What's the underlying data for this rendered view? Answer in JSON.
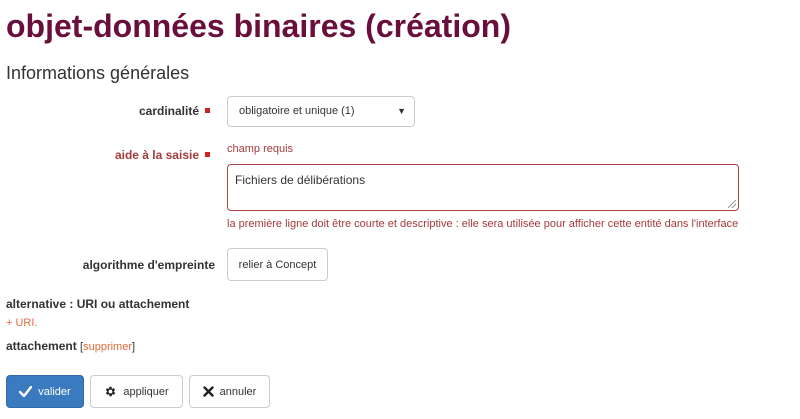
{
  "header": {
    "title": "objet-données binaires (création)",
    "section": "Informations générales"
  },
  "form": {
    "cardinality": {
      "label": "cardinalité",
      "selected": "obligatoire et unique (1)"
    },
    "help": {
      "label": "aide à la saisie",
      "error": "champ requis",
      "value": "Fichiers de délibérations",
      "hint": "la première ligne doit être courte et descriptive : elle sera utilisée pour afficher cette entité dans l'interface"
    },
    "hash_algorithm": {
      "label": "algorithme d'empreinte",
      "button": "relier à Concept"
    },
    "alternative": {
      "label": "alternative : URI ou attachement",
      "link": "+ URI."
    },
    "attachment": {
      "label": "attachement",
      "open_bracket": "[",
      "link": "supprimer",
      "close_bracket": "]"
    }
  },
  "actions": {
    "validate": "valider",
    "apply": "appliquer",
    "cancel": "annuler"
  },
  "colors": {
    "title": "#6a0f3b",
    "error": "#a33b3b",
    "required_marker": "#cc2222",
    "link": "#e06a3a",
    "primary": "#3a7bbf"
  },
  "icons": {
    "validate": "check-icon",
    "apply": "gear-icon",
    "cancel": "close-icon",
    "select": "caret-down-icon"
  }
}
